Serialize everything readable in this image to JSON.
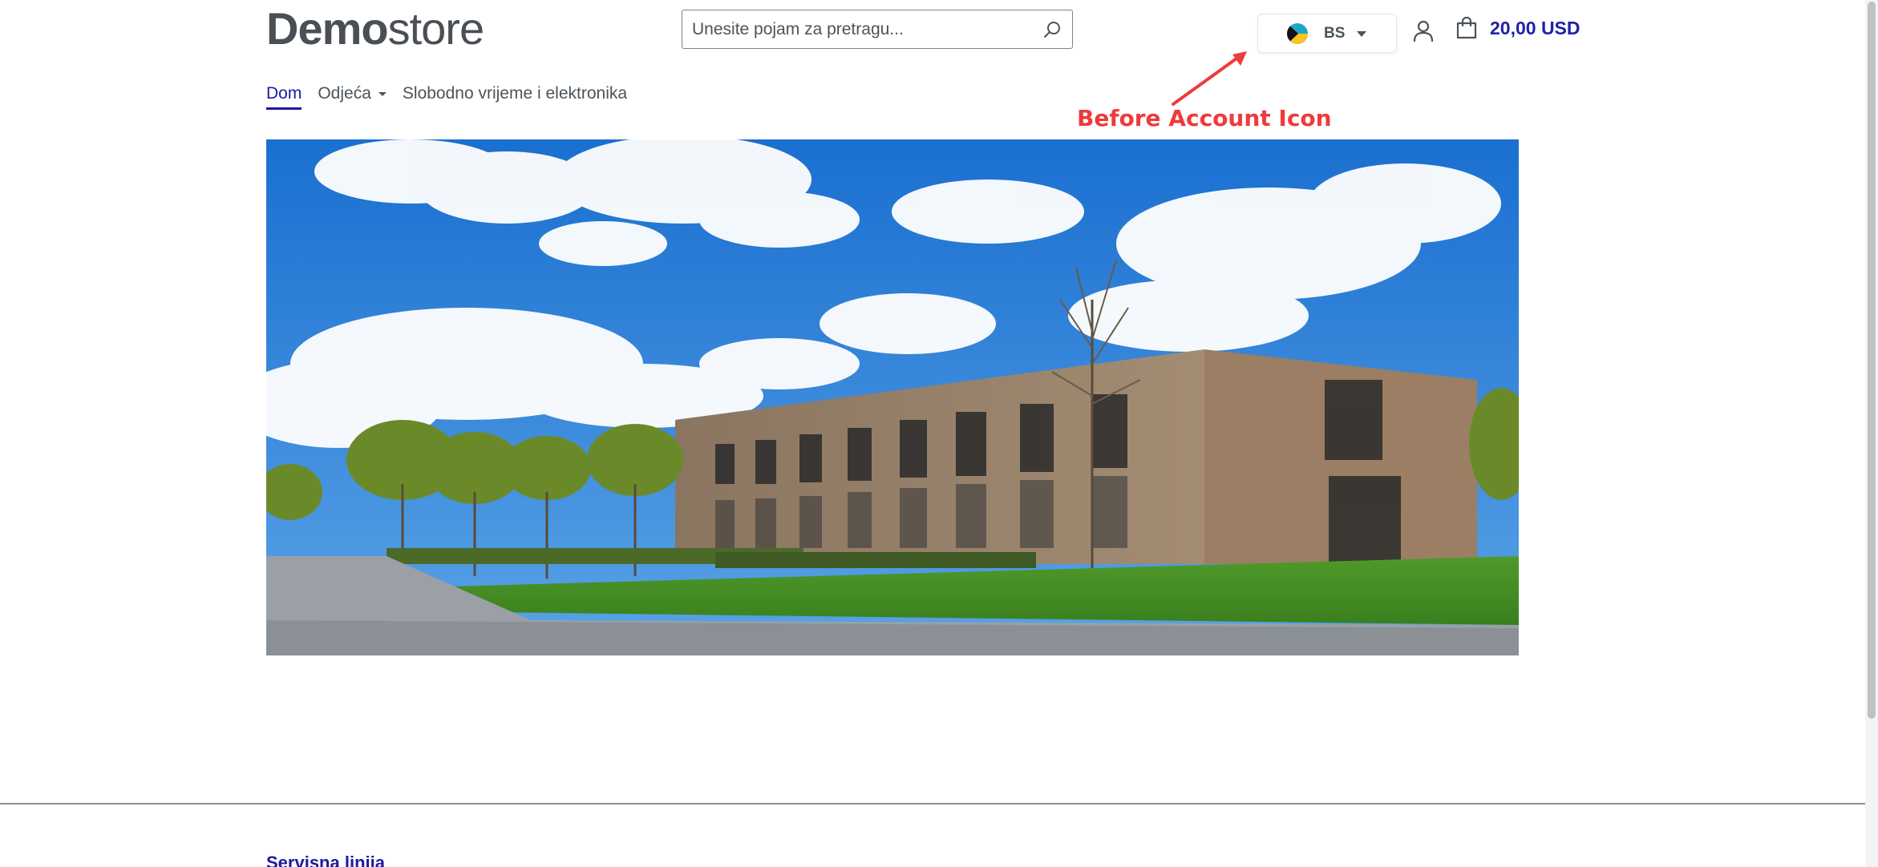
{
  "header": {
    "logo": {
      "bold": "Demo",
      "light": "store"
    },
    "search": {
      "placeholder": "Unesite pojam za pretragu...",
      "value": ""
    },
    "language": {
      "code": "BS"
    },
    "cart": {
      "total": "20,00 USD"
    }
  },
  "nav": {
    "items": [
      {
        "label": "Dom"
      },
      {
        "label": "Odjeća"
      },
      {
        "label": "Slobodno vrijeme i elektronika"
      }
    ]
  },
  "annotation": {
    "text": "Before Account Icon",
    "color": "#ee3b3b"
  },
  "footer": {
    "heading": "Servisna linija"
  },
  "colors": {
    "brand": "#1c1aa0",
    "annotation": "#ee3b3b"
  }
}
